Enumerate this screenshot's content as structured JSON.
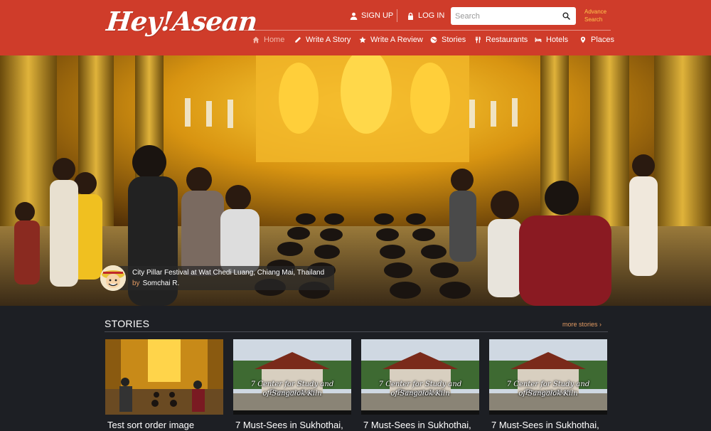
{
  "brand": {
    "logo_text": "Hey!Asean"
  },
  "header": {
    "signup_label": "SIGN UP",
    "login_label": "LOG IN",
    "search_placeholder": "Search",
    "advance_search_line1": "Advance",
    "advance_search_line2": "Search"
  },
  "nav": {
    "items": [
      {
        "label": "Home",
        "icon": "home-icon",
        "active": true
      },
      {
        "label": "Write A Story",
        "icon": "pencil-icon"
      },
      {
        "label": "Write A Review",
        "icon": "star-icon"
      },
      {
        "label": "Stories",
        "icon": "globe-icon"
      },
      {
        "label": "Restaurants",
        "icon": "utensils-icon"
      },
      {
        "label": "Hotels",
        "icon": "bed-icon"
      },
      {
        "label": "Places",
        "icon": "map-marker-icon"
      }
    ]
  },
  "hero": {
    "caption_title": "City Pillar Festival at Wat Chedi Luang, Chiang Mai, Thailand",
    "caption_by": "by",
    "caption_author": "Somchai R."
  },
  "stories": {
    "section_title": "STORIES",
    "more_label": "more stories ›",
    "cards": [
      {
        "title": "Test sort order image"
      },
      {
        "title": "7 Must-Sees in Sukhothai,",
        "thumb_line1": "7 Center for Study and Preservation",
        "thumb_line2": "of Sangalok Kiln"
      },
      {
        "title": "7 Must-Sees in Sukhothai,",
        "thumb_line1": "7 Center for Study and Preservation",
        "thumb_line2": "of Sangalok Kiln"
      },
      {
        "title": "7 Must-Sees in Sukhothai,",
        "thumb_line1": "7 Center for Study and Preservation",
        "thumb_line2": "of Sangalok Kiln"
      }
    ]
  },
  "colors": {
    "header_bg": "#cf3c2a",
    "accent_orange": "#e29a62",
    "advance_search": "#ffc44d",
    "page_bg": "#1d1f24"
  }
}
